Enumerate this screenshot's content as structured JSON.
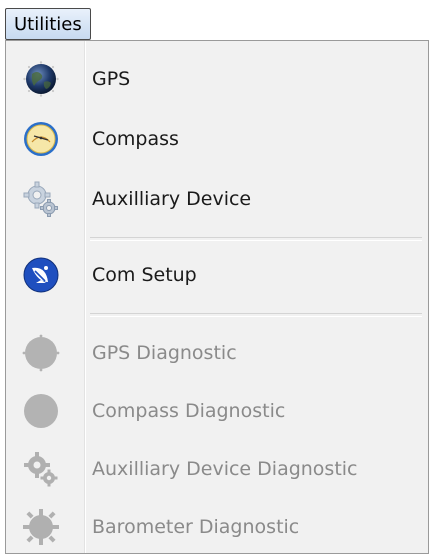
{
  "menubar": {
    "utilities_label": "Utilities"
  },
  "menu": {
    "items": [
      {
        "label": "GPS",
        "icon": "globe-icon",
        "enabled": true
      },
      {
        "label": "Compass",
        "icon": "compass-icon",
        "enabled": true
      },
      {
        "label": "Auxilliary Device",
        "icon": "gears-icon",
        "enabled": true
      },
      {
        "label": "Com Setup",
        "icon": "satellite-dish-icon",
        "enabled": true
      },
      {
        "label": "GPS Diagnostic",
        "icon": "gps-diagnostic-icon",
        "enabled": false
      },
      {
        "label": "Compass Diagnostic",
        "icon": "compass-diagnostic-icon",
        "enabled": false
      },
      {
        "label": "Auxilliary Device Diagnostic",
        "icon": "gears-diagnostic-icon",
        "enabled": false
      },
      {
        "label": "Barometer Diagnostic",
        "icon": "barometer-diagnostic-icon",
        "enabled": false
      }
    ]
  },
  "colors": {
    "menu_background": "#f1f1f1",
    "disabled_text": "#8a8a8a",
    "enabled_text": "#1a1a1a",
    "disabled_icon": "#b0b0b0",
    "com_setup_blue": "#1f4fbf"
  }
}
